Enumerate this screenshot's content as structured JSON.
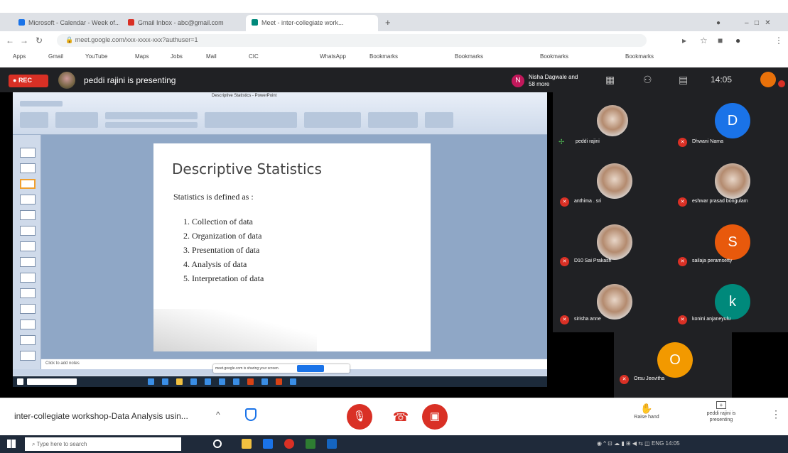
{
  "browser": {
    "tabs": [
      {
        "label": "Microsoft - Calendar - Week of...",
        "color": "#1a73e8",
        "active": false
      },
      {
        "label": "Gmail Inbox - abc@gmail.com",
        "color": "#d93025",
        "active": false
      },
      {
        "label": "Meet - inter-collegiate work...",
        "color": "#00897b",
        "active": true
      }
    ],
    "new_tab": "+",
    "address": "meet.google.com/xxx-xxxx-xxx?authuser=1",
    "bookmarks": [
      "Apps",
      "Gmail",
      "YouTube",
      "Maps",
      "Jobs",
      "Mail",
      "CIC",
      "WhatsApp",
      "Bookmarks",
      "Bookmarks",
      "Bookmarks",
      "Bookmarks"
    ]
  },
  "meet": {
    "rec_label": "REC",
    "presenter_text": "peddi rajini is presenting",
    "participant_initial": "N",
    "participant_text": "Nisha Dagwale and 58 more",
    "time": "14:05",
    "participants": [
      {
        "name": "peddi rajini",
        "initial": "",
        "color": "",
        "photo": true
      },
      {
        "name": "Dhwani Nama",
        "initial": "D",
        "color": "#1a73e8",
        "photo": false
      },
      {
        "name": "anthima . sri",
        "initial": "",
        "color": "",
        "photo": true
      },
      {
        "name": "eshwar prasad bongulam",
        "initial": "",
        "color": "",
        "photo": true
      },
      {
        "name": "D10 Sai Prakash",
        "initial": "",
        "color": "",
        "photo": true
      },
      {
        "name": "sailaja peramsetty",
        "initial": "S",
        "color": "#e8590c",
        "photo": false
      },
      {
        "name": "sirisha anne",
        "initial": "",
        "color": "",
        "photo": true
      },
      {
        "name": "konini anjaneyulu",
        "initial": "k",
        "color": "#00897b",
        "photo": false
      },
      {
        "name": "Orsu Jeevitha",
        "initial": "O",
        "color": "#f29900",
        "photo": false
      }
    ],
    "meeting_title": "inter-collegiate workshop-Data Analysis usin...",
    "raise_hand": "Raise hand",
    "presenting_label": "peddi rajini is presenting"
  },
  "slide": {
    "window_title": "Descriptive Statistics - PowerPoint",
    "title": "Descriptive Statistics",
    "definition": "Statistics is defined as :",
    "items": [
      "1. Collection of data",
      "2. Organization of data",
      "3. Presentation of data",
      "4. Analysis of data",
      "5. Interpretation of data"
    ],
    "notes_placeholder": "Click to add notes",
    "notice_text": "meet.google.com is sharing your screen."
  },
  "taskbar": {
    "search_placeholder": "Type here to search",
    "tray_text": "ENG 14:05"
  }
}
